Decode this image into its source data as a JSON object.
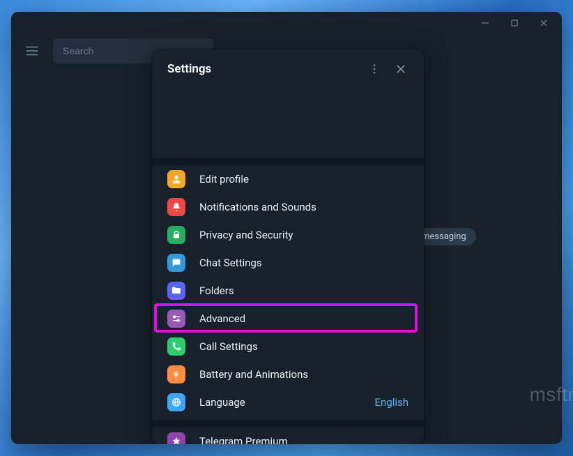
{
  "search": {
    "placeholder": "Search"
  },
  "tag": "messaging",
  "watermark": "msftnext.com",
  "settings": {
    "title": "Settings",
    "items": [
      {
        "label": "Edit profile"
      },
      {
        "label": "Notifications and Sounds"
      },
      {
        "label": "Privacy and Security"
      },
      {
        "label": "Chat Settings"
      },
      {
        "label": "Folders"
      },
      {
        "label": "Advanced"
      },
      {
        "label": "Call Settings"
      },
      {
        "label": "Battery and Animations"
      },
      {
        "label": "Language",
        "value": "English"
      },
      {
        "label": "Telegram Premium"
      }
    ]
  }
}
